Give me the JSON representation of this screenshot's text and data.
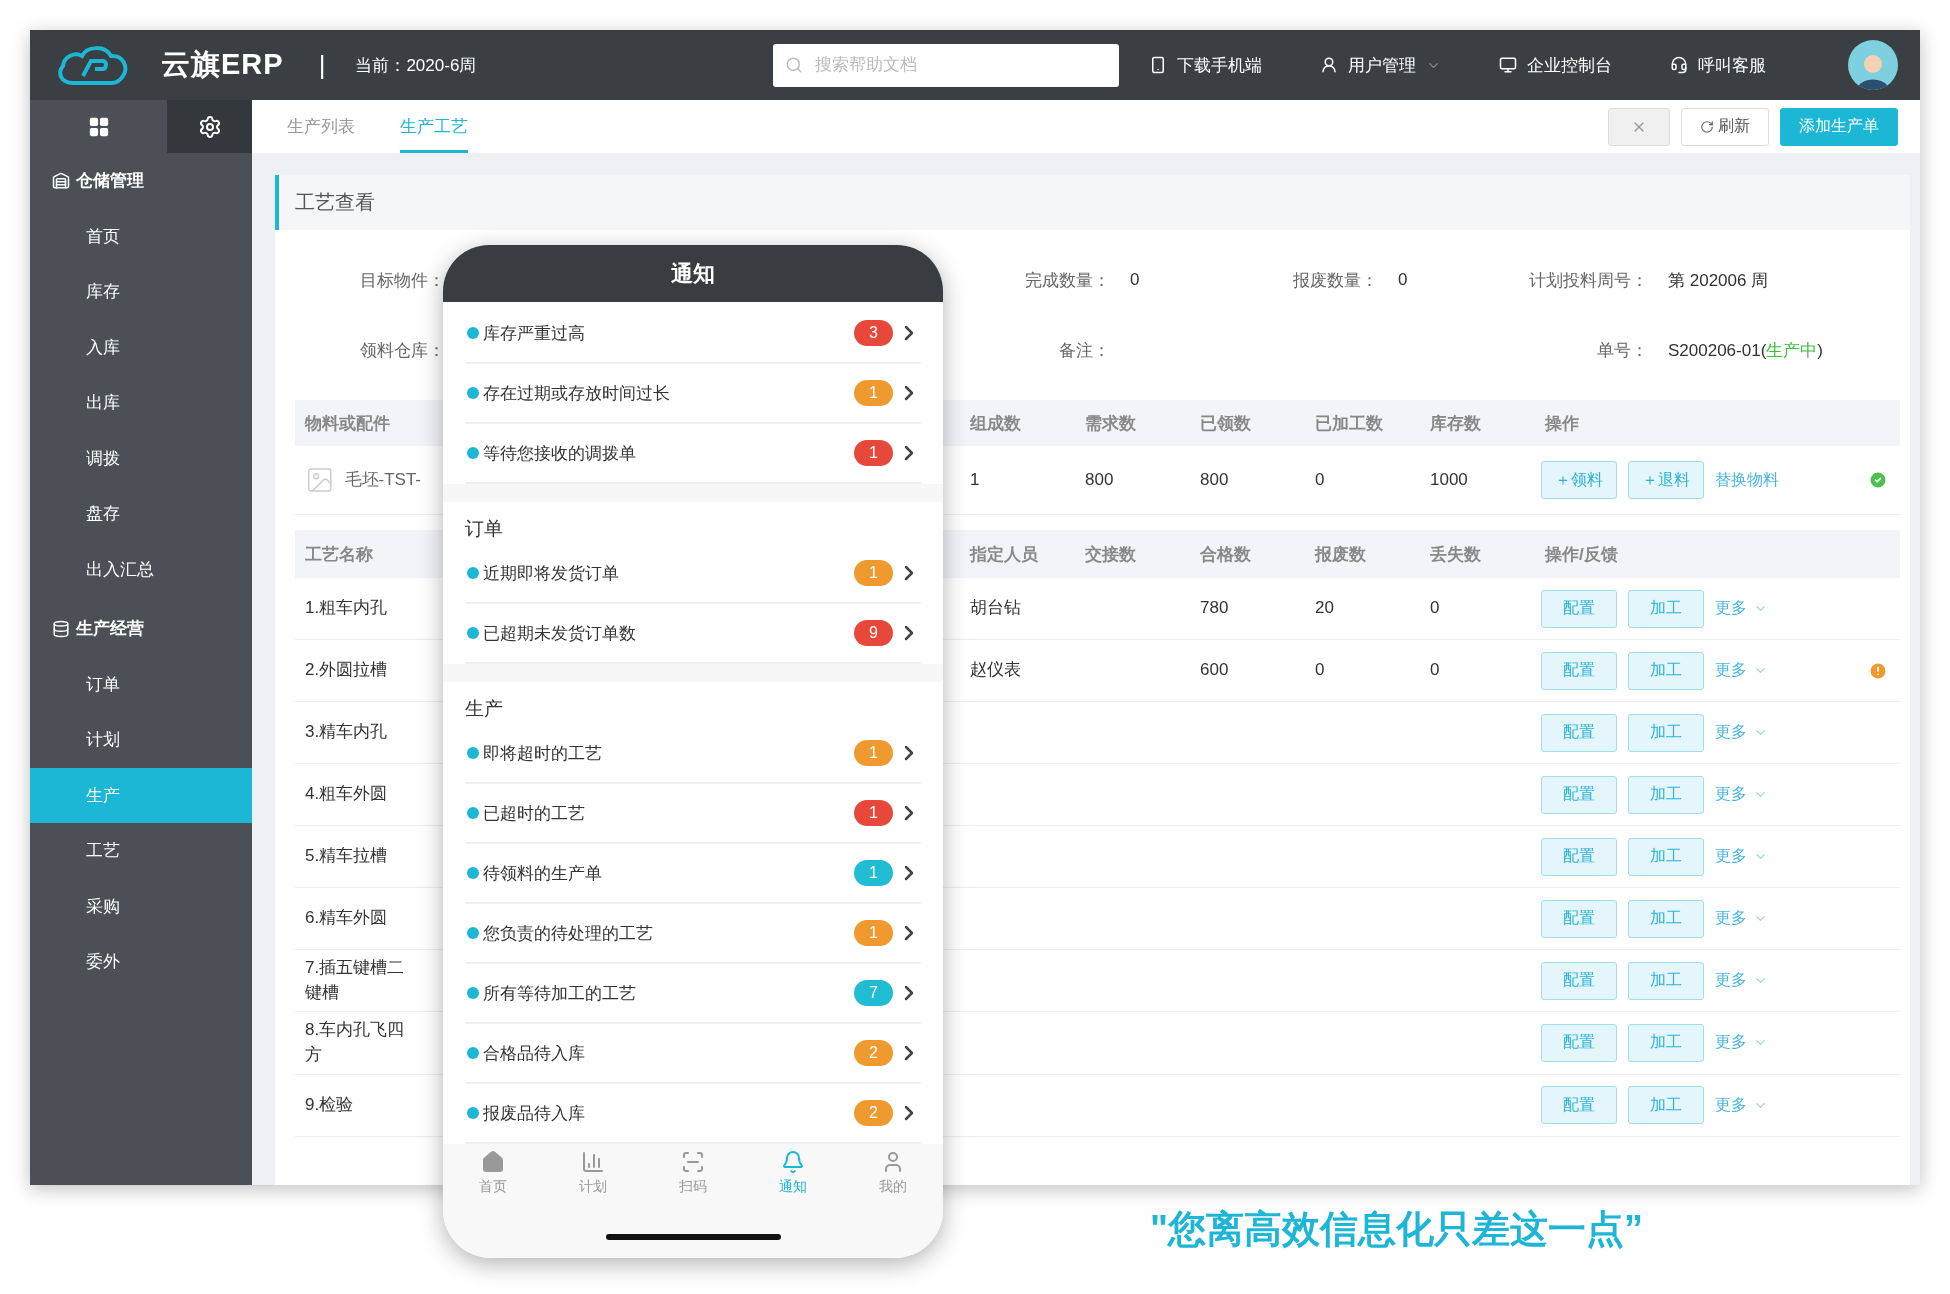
{
  "topbar": {
    "brand": "云旗ERP",
    "separator": "|",
    "period": "当前：2020-6周",
    "search": {
      "placeholder": "搜索帮助文档"
    },
    "actions": [
      {
        "label": "下载手机端",
        "kind": "phone"
      },
      {
        "label": "用户管理",
        "kind": "user",
        "dropdown": true
      },
      {
        "label": "企业控制台",
        "kind": "monitor"
      },
      {
        "label": "呼叫客服",
        "kind": "headset"
      }
    ]
  },
  "sidebar": {
    "groups": [
      {
        "title": "仓储管理",
        "kind": "warehouse",
        "items": [
          {
            "label": "首页",
            "selected": false
          },
          {
            "label": "库存",
            "selected": false
          },
          {
            "label": "入库",
            "selected": false
          },
          {
            "label": "出库",
            "selected": false
          },
          {
            "label": "调拨",
            "selected": false
          },
          {
            "label": "盘存",
            "selected": false
          },
          {
            "label": "出入汇总",
            "selected": false
          }
        ]
      },
      {
        "title": "生产经营",
        "kind": "production",
        "items": [
          {
            "label": "订单",
            "selected": false
          },
          {
            "label": "计划",
            "selected": false
          },
          {
            "label": "生产",
            "selected": true
          },
          {
            "label": "工艺",
            "selected": false
          },
          {
            "label": "采购",
            "selected": false
          },
          {
            "label": "委外",
            "selected": false
          }
        ]
      }
    ]
  },
  "tabs": [
    {
      "label": "生产列表",
      "selected": false
    },
    {
      "label": "生产工艺",
      "selected": true
    }
  ],
  "toolbar": [
    {
      "kind": "close"
    },
    {
      "kind": "refresh",
      "label": "刷新"
    },
    {
      "kind": "primary",
      "label": "添加生产单"
    }
  ],
  "panel": {
    "title": "工艺查看",
    "form_rows": [
      [
        {
          "label": "目标物件："
        },
        {
          "label": "完成数量：",
          "value": "0"
        },
        {
          "label": "报废数量：",
          "value": "0"
        },
        {
          "label": "计划投料周号：",
          "value": "第 202006 周"
        }
      ],
      [
        {
          "label": "领料仓库："
        },
        {
          "label": "备注："
        },
        {
          "label": "单号：",
          "value": "S200206-01(",
          "status": "生产中",
          "closing": ")"
        }
      ]
    ],
    "materials": {
      "columns": [
        "物料或配件",
        "组成数",
        "需求数",
        "已领数",
        "已加工数",
        "库存数",
        "操作"
      ],
      "rows": [
        {
          "name": "毛坯-TST-",
          "composition": "1",
          "required": "800",
          "received": "800",
          "processed": "0",
          "stock": "1000",
          "complete": true,
          "actions": [
            {
              "label": "＋领料",
              "kind": "button"
            },
            {
              "label": "＋退料",
              "kind": "button"
            },
            {
              "label": "替换物料",
              "kind": "link"
            }
          ]
        }
      ]
    },
    "processes": {
      "columns": [
        "工艺名称",
        "指定人员",
        "交接数",
        "合格数",
        "报废数",
        "丢失数",
        "操作/反馈"
      ],
      "rows": [
        {
          "name": "1.粗车内孔",
          "assignee": "胡台钻",
          "qualified": "780",
          "scrapped": "20",
          "lost": "0",
          "flagged": false,
          "actions": [
            {
              "label": "配置",
              "kind": "button"
            },
            {
              "label": "加工",
              "kind": "button"
            },
            {
              "label": "更多",
              "kind": "menu"
            }
          ]
        },
        {
          "name": "2.外圆拉槽",
          "assignee": "赵仪表",
          "qualified": "600",
          "scrapped": "0",
          "lost": "0",
          "flagged": true,
          "actions": [
            {
              "label": "配置",
              "kind": "button"
            },
            {
              "label": "加工",
              "kind": "button"
            },
            {
              "label": "更多",
              "kind": "menu"
            }
          ]
        },
        {
          "name": "3.精车内孔",
          "flagged": false,
          "actions": [
            {
              "label": "配置",
              "kind": "button"
            },
            {
              "label": "加工",
              "kind": "button"
            },
            {
              "label": "更多",
              "kind": "menu"
            }
          ]
        },
        {
          "name": "4.粗车外圆",
          "flagged": false,
          "actions": [
            {
              "label": "配置",
              "kind": "button"
            },
            {
              "label": "加工",
              "kind": "button"
            },
            {
              "label": "更多",
              "kind": "menu"
            }
          ]
        },
        {
          "name": "5.精车拉槽",
          "flagged": false,
          "actions": [
            {
              "label": "配置",
              "kind": "button"
            },
            {
              "label": "加工",
              "kind": "button"
            },
            {
              "label": "更多",
              "kind": "menu"
            }
          ]
        },
        {
          "name": "6.精车外圆",
          "flagged": false,
          "actions": [
            {
              "label": "配置",
              "kind": "button"
            },
            {
              "label": "加工",
              "kind": "button"
            },
            {
              "label": "更多",
              "kind": "menu"
            }
          ]
        },
        {
          "name": "7.插五键槽二键槽",
          "flagged": false,
          "actions": [
            {
              "label": "配置",
              "kind": "button"
            },
            {
              "label": "加工",
              "kind": "button"
            },
            {
              "label": "更多",
              "kind": "menu"
            }
          ]
        },
        {
          "name": "8.车内孔飞四方",
          "flagged": false,
          "actions": [
            {
              "label": "配置",
              "kind": "button"
            },
            {
              "label": "加工",
              "kind": "button"
            },
            {
              "label": "更多",
              "kind": "menu"
            }
          ]
        },
        {
          "name": "9.检验",
          "flagged": false,
          "actions": [
            {
              "label": "配置",
              "kind": "button"
            },
            {
              "label": "加工",
              "kind": "button"
            },
            {
              "label": "更多",
              "kind": "menu"
            }
          ]
        }
      ]
    }
  },
  "phone": {
    "title": "通知",
    "sections": [
      {
        "items": [
          {
            "label": "库存严重过高",
            "count": "3",
            "color": "#e8483a"
          },
          {
            "label": "存在过期或存放时间过长",
            "count": "1",
            "color": "#ef9a2f"
          },
          {
            "label": "等待您接收的调拨单",
            "count": "1",
            "color": "#e8483a"
          }
        ]
      },
      {
        "title": "订单",
        "items": [
          {
            "label": "近期即将发货订单",
            "count": "1",
            "color": "#ef9a2f"
          },
          {
            "label": "已超期未发货订单数",
            "count": "9",
            "color": "#e8483a"
          }
        ]
      },
      {
        "title": "生产",
        "items": [
          {
            "label": "即将超时的工艺",
            "count": "1",
            "color": "#ef9a2f"
          },
          {
            "label": "已超时的工艺",
            "count": "1",
            "color": "#e8483a"
          },
          {
            "label": "待领料的生产单",
            "count": "1",
            "color": "#1fbcd2"
          },
          {
            "label": "您负责的待处理的工艺",
            "count": "1",
            "color": "#ef9a2f"
          },
          {
            "label": "所有等待加工的工艺",
            "count": "7",
            "color": "#1fbcd2"
          },
          {
            "label": "合格品待入库",
            "count": "2",
            "color": "#ef9a2f"
          },
          {
            "label": "报废品待入库",
            "count": "2",
            "color": "#ef9a2f"
          }
        ]
      }
    ],
    "tabbar": [
      {
        "label": "首页",
        "kind": "home",
        "selected": false
      },
      {
        "label": "计划",
        "kind": "plan",
        "selected": false
      },
      {
        "label": "扫码",
        "kind": "scan",
        "selected": false
      },
      {
        "label": "通知",
        "kind": "bell",
        "selected": true
      },
      {
        "label": "我的",
        "kind": "profile",
        "selected": false
      }
    ]
  },
  "tagline": "\"您离高效信息化只差这一点”"
}
